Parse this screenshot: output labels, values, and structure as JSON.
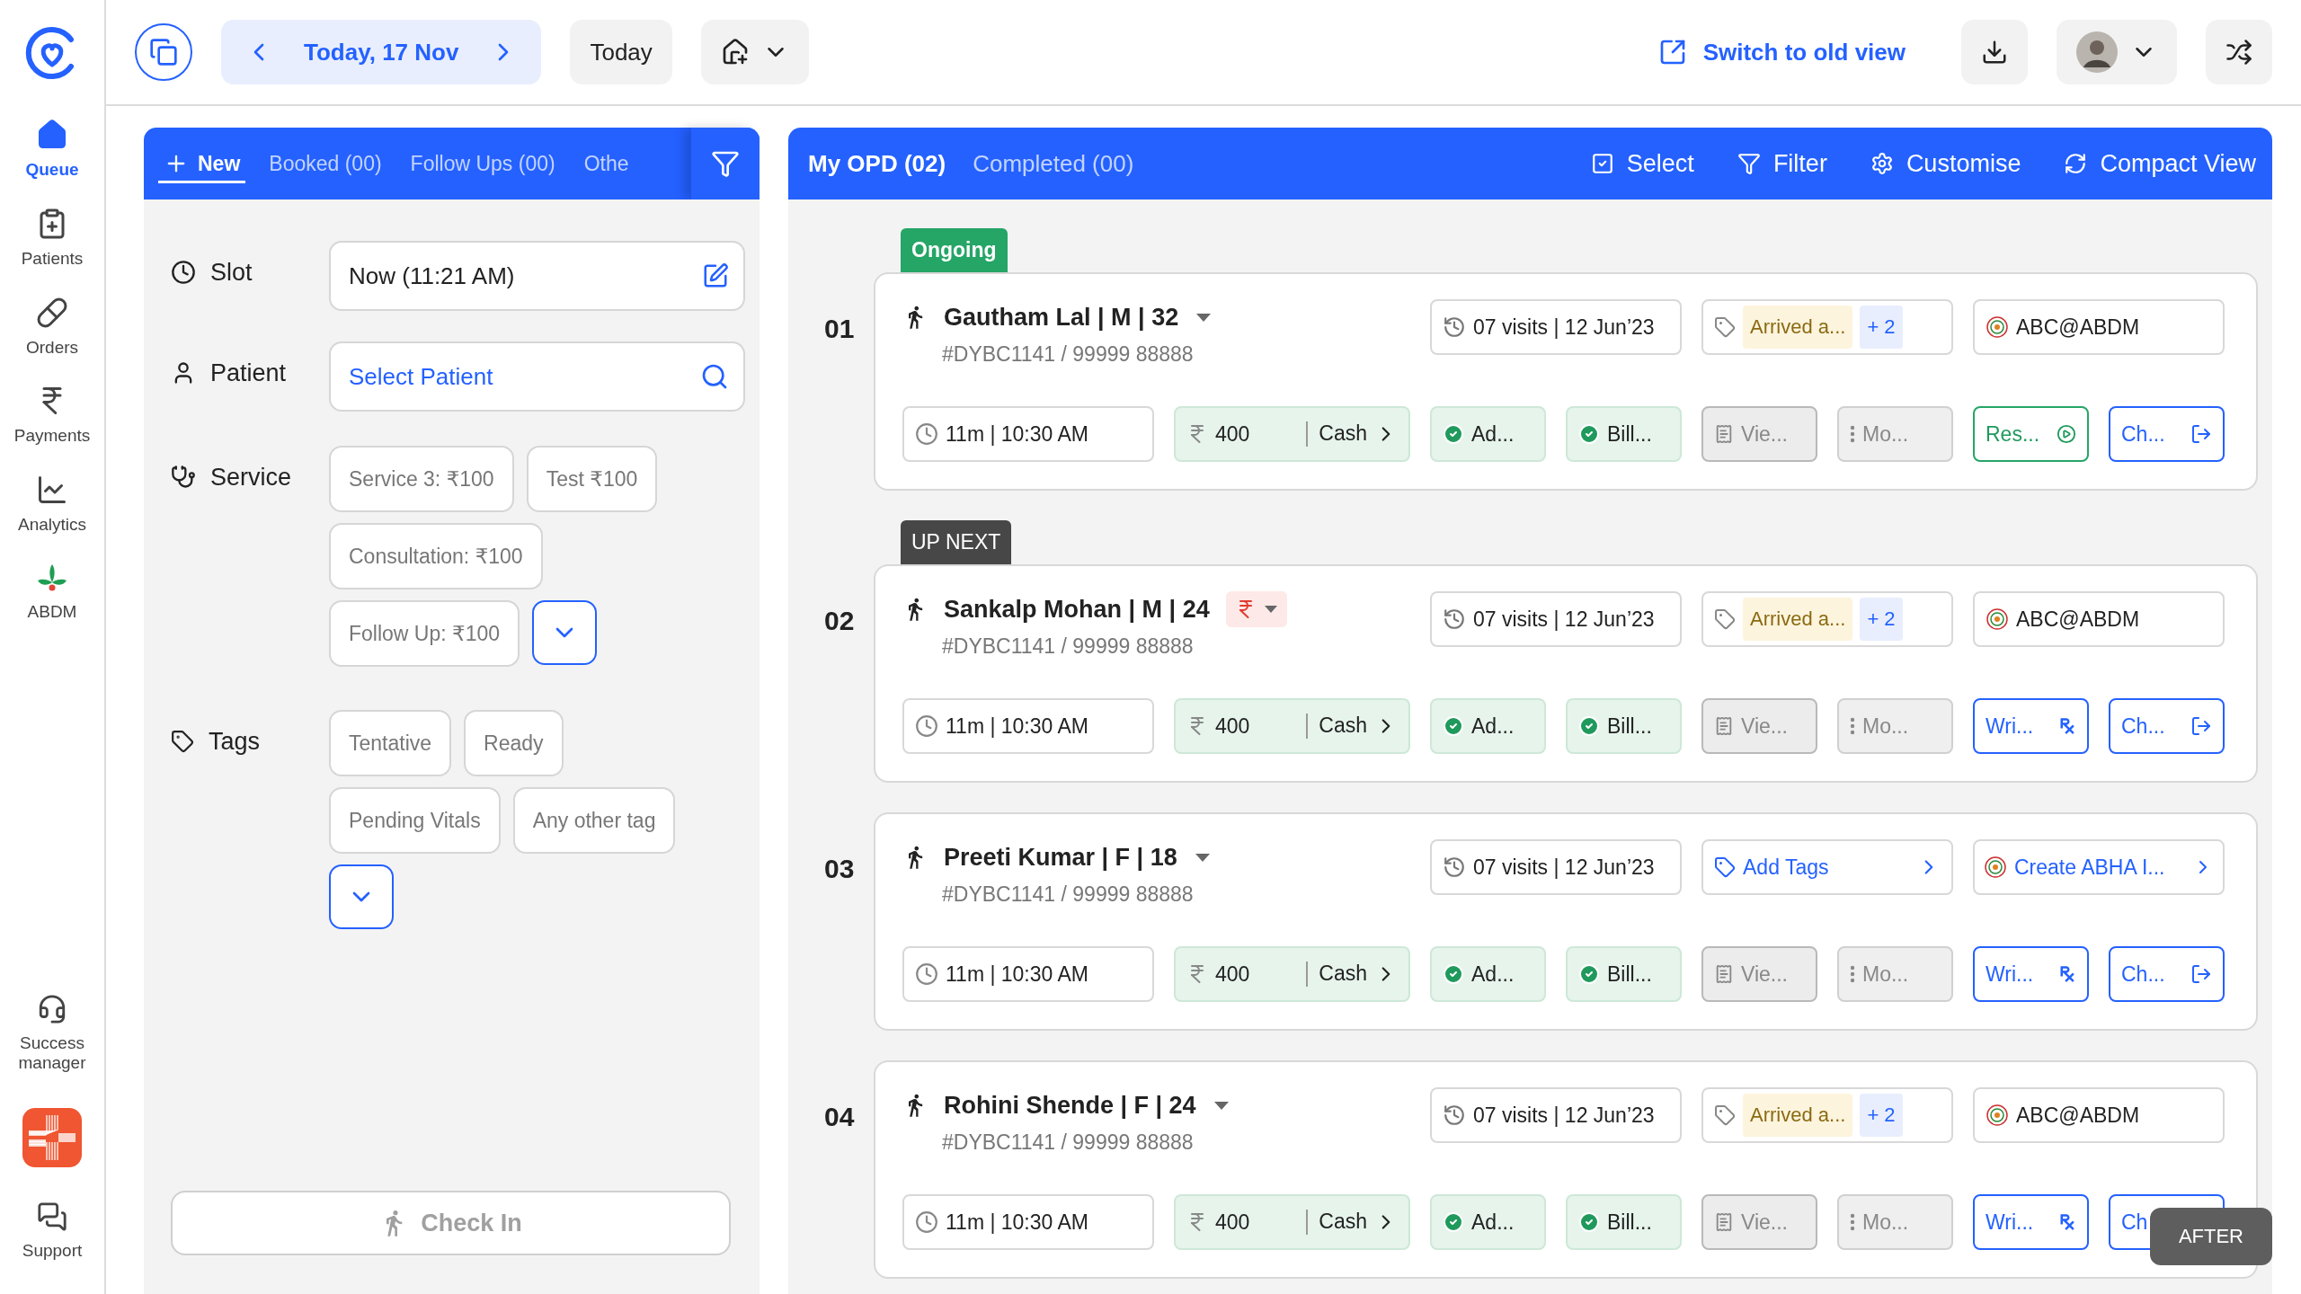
{
  "sidebar": {
    "items": [
      {
        "label": "Queue",
        "selected": true
      },
      {
        "label": "Patients",
        "selected": false
      },
      {
        "label": "Orders",
        "selected": false
      },
      {
        "label": "Payments",
        "selected": false
      },
      {
        "label": "Analytics",
        "selected": false
      },
      {
        "label": "ABDM",
        "selected": false
      }
    ],
    "bottom_items": [
      {
        "kind": "link",
        "label": "Success manager"
      },
      {
        "kind": "app"
      },
      {
        "kind": "link",
        "label": "Support"
      }
    ]
  },
  "topbar": {
    "date": "Today, 17 Nov",
    "today_button": "Today",
    "switch_link": "Switch to old view"
  },
  "left_panel": {
    "tabs": [
      {
        "label": "New",
        "selected": true
      },
      {
        "label": "Booked (00)",
        "selected": false
      },
      {
        "label": "Follow Ups (00)",
        "selected": false
      },
      {
        "label": "Othe",
        "selected": false
      }
    ],
    "slot": {
      "label": "Slot",
      "value": "Now (11:21 AM)"
    },
    "patient": {
      "label": "Patient",
      "placeholder": "Select Patient"
    },
    "service": {
      "label": "Service",
      "options": [
        "Service 3: ₹100",
        "Test ₹100",
        "Consultation: ₹100",
        "Follow Up: ₹100"
      ]
    },
    "tags": {
      "label": "Tags",
      "options": [
        "Tentative",
        "Ready",
        "Pending Vitals",
        "Any other tag"
      ]
    },
    "check_in": {
      "label": "Check In",
      "disabled": true
    }
  },
  "right_panel": {
    "tabs": [
      {
        "label": "My OPD (02)",
        "selected": true
      },
      {
        "label": "Completed (00)",
        "selected": false
      }
    ],
    "actions": [
      "Select",
      "Filter",
      "Customise",
      "Compact View"
    ],
    "queue": [
      {
        "index": "01",
        "badge": {
          "kind": "ongoing",
          "label": "Ongoing"
        },
        "name": "Gautham Lal | M | 32",
        "payment_pending": false,
        "patient_id": "#DYBC1141 / 99999 88888",
        "visits": "07 visits | 12 Jun’23",
        "tags": {
          "kind": "tagged",
          "tag": "Arrived a...",
          "more": "+ 2"
        },
        "abha": {
          "kind": "linked",
          "text": "ABC@ABDM"
        },
        "time": "11m | 10:30 AM",
        "amount": "400",
        "mode": "Cash",
        "admission": "Ad...",
        "bill": "Bill...",
        "view": "Vie...",
        "more": "Mo...",
        "rx": {
          "kind": "resume",
          "label": "Res..."
        },
        "checkout": {
          "kind": "with_icon",
          "label": "Ch..."
        }
      },
      {
        "index": "02",
        "badge": {
          "kind": "up_next",
          "label": "UP NEXT"
        },
        "name": "Sankalp Mohan | M | 24",
        "payment_pending": true,
        "patient_id": "#DYBC1141 / 99999 88888",
        "visits": "07 visits | 12 Jun’23",
        "tags": {
          "kind": "tagged",
          "tag": "Arrived a...",
          "more": "+ 2"
        },
        "abha": {
          "kind": "linked",
          "text": "ABC@ABDM"
        },
        "time": "11m | 10:30 AM",
        "amount": "400",
        "mode": "Cash",
        "admission": "Ad...",
        "bill": "Bill...",
        "view": "Vie...",
        "more": "Mo...",
        "rx": {
          "kind": "write",
          "label": "Wri..."
        },
        "checkout": {
          "kind": "with_icon",
          "label": "Ch..."
        }
      },
      {
        "index": "03",
        "name": "Preeti Kumar | F | 18",
        "payment_pending": false,
        "patient_id": "#DYBC1141 / 99999 88888",
        "visits": "07 visits | 12 Jun’23",
        "tags": {
          "kind": "add",
          "label": "Add Tags"
        },
        "abha": {
          "kind": "create",
          "text": "Create ABHA I..."
        },
        "time": "11m | 10:30 AM",
        "amount": "400",
        "mode": "Cash",
        "admission": "Ad...",
        "bill": "Bill...",
        "view": "Vie...",
        "more": "Mo...",
        "rx": {
          "kind": "write",
          "label": "Wri..."
        },
        "checkout": {
          "kind": "with_icon",
          "label": "Ch..."
        }
      },
      {
        "index": "04",
        "name": "Rohini Shende | F | 24",
        "payment_pending": false,
        "patient_id": "#DYBC1141 / 99999 88888",
        "visits": "07 visits | 12 Jun’23",
        "tags": {
          "kind": "tagged",
          "tag": "Arrived a...",
          "more": "+ 2"
        },
        "abha": {
          "kind": "linked",
          "text": "ABC@ABDM"
        },
        "time": "11m | 10:30 AM",
        "amount": "400",
        "mode": "Cash",
        "admission": "Ad...",
        "bill": "Bill...",
        "view": "Vie...",
        "more": "Mo...",
        "rx": {
          "kind": "write",
          "label": "Wri..."
        },
        "checkout": {
          "kind": "label_only",
          "label": "Ch"
        }
      }
    ]
  },
  "overlay_badge": "AFTER"
}
